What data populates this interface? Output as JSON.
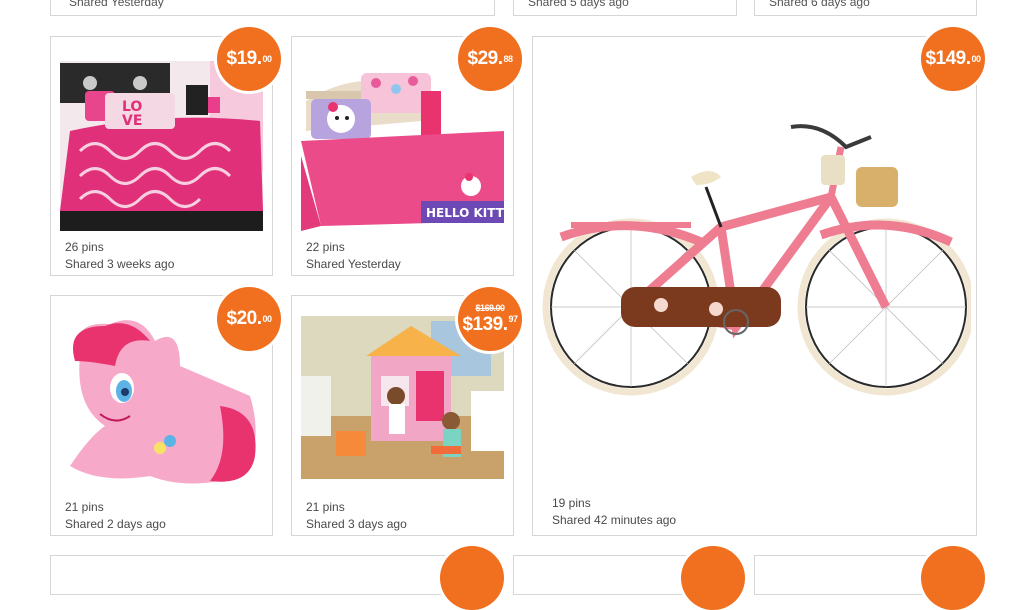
{
  "top_row": [
    {
      "shared": "Shared Yesterday"
    },
    {
      "shared": "Shared 5 days ago"
    },
    {
      "shared": "Shared 6 days ago"
    }
  ],
  "products": [
    {
      "name": "pink-love-comforter-set",
      "price": "$19.",
      "cents": "00",
      "pins": "26 pins",
      "shared": "Shared 3 weeks ago"
    },
    {
      "name": "hello-kitty-bedding",
      "price": "$29.",
      "cents": "88",
      "pins": "22 pins",
      "shared": "Shared Yesterday"
    },
    {
      "name": "pinkie-pie-pillow",
      "price": "$20.",
      "cents": "00",
      "pins": "21 pins",
      "shared": "Shared 2 days ago"
    },
    {
      "name": "lalaloopsy-playhouse",
      "was": "$169.00",
      "price": "$139.",
      "cents": "97",
      "pins": "21 pins",
      "shared": "Shared 3 days ago"
    },
    {
      "name": "pink-cruiser-bicycle",
      "price": "$149.",
      "cents": "00",
      "pins": "19 pins",
      "shared": "Shared 42 minutes ago"
    }
  ],
  "colors": {
    "price_badge": "#f0701f",
    "card_border": "#d6d6d6"
  }
}
